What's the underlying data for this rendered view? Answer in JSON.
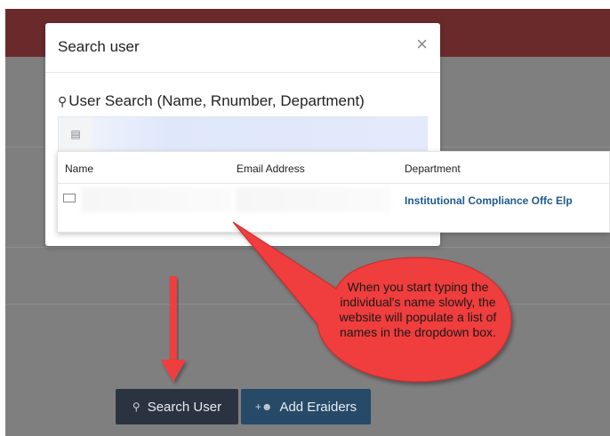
{
  "modal": {
    "title": "Search user",
    "close_glyph": "×",
    "search_label": "User Search (Name, Rnumber, Department)",
    "search_icon": "user-search-icon",
    "input_addon_icon": "id-card-icon",
    "input_value": ""
  },
  "dropdown": {
    "columns": [
      "Name",
      "Email Address",
      "Department"
    ],
    "rows": [
      {
        "icon": "id-card-icon",
        "name": "",
        "email": "",
        "department": "Institutional Compliance Offc Elp"
      }
    ]
  },
  "buttons": {
    "search_user": "Search User",
    "add_eraiders": "Add Eraiders"
  },
  "annotation": {
    "callout": "When you start typing the individual's name slowly, the website will populate a list of names in the dropdown box.",
    "callout_color": "#f03e3e",
    "arrow_color": "#f03e3e"
  },
  "colors": {
    "header_bar": "#6a2a2c",
    "overlay": "#7f7f7f",
    "search_button": "#2c3340",
    "add_button": "#264a68",
    "department_link": "#1f5a8f"
  }
}
